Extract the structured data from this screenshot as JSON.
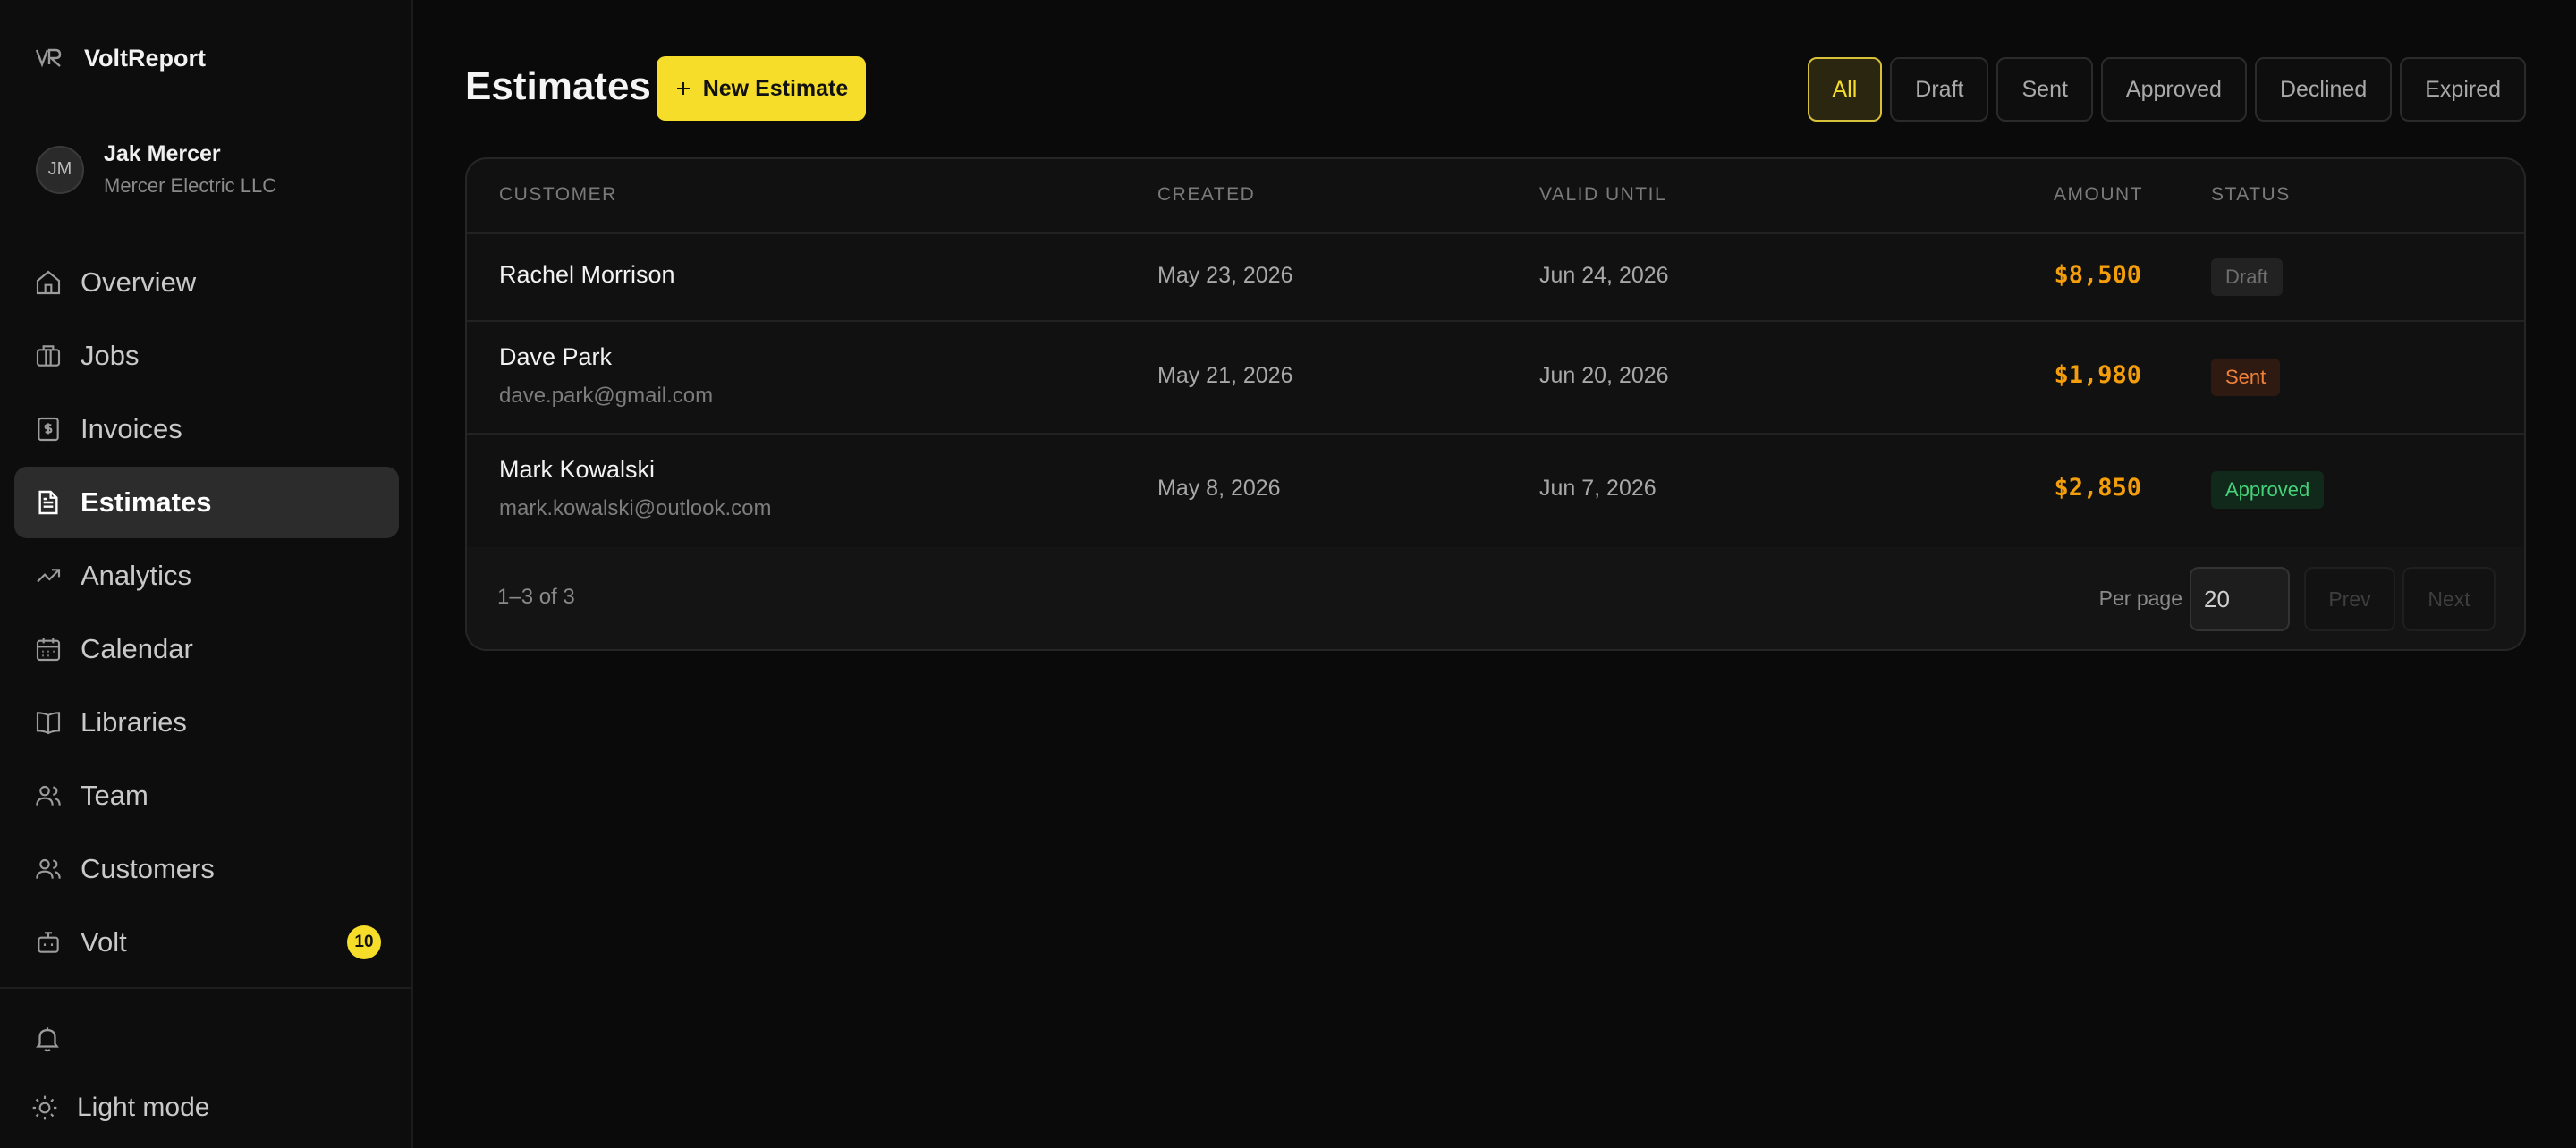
{
  "app": {
    "name": "VoltReport"
  },
  "user": {
    "initials": "JM",
    "name": "Jak Mercer",
    "company": "Mercer Electric LLC"
  },
  "nav": [
    {
      "label": "Overview",
      "icon": "home-icon"
    },
    {
      "label": "Jobs",
      "icon": "briefcase-icon"
    },
    {
      "label": "Invoices",
      "icon": "invoice-dollar-icon"
    },
    {
      "label": "Estimates",
      "icon": "document-icon",
      "active": true
    },
    {
      "label": "Analytics",
      "icon": "trending-up-icon"
    },
    {
      "label": "Calendar",
      "icon": "calendar-icon"
    },
    {
      "label": "Libraries",
      "icon": "book-icon"
    },
    {
      "label": "Team",
      "icon": "users-icon"
    },
    {
      "label": "Customers",
      "icon": "customers-icon"
    },
    {
      "label": "Volt",
      "icon": "bot-icon",
      "badge": "10"
    }
  ],
  "footer_nav": {
    "light_mode_label": "Light mode"
  },
  "page": {
    "title": "Estimates",
    "new_button_label": "New Estimate"
  },
  "filters": [
    "All",
    "Draft",
    "Sent",
    "Approved",
    "Declined",
    "Expired"
  ],
  "active_filter": "All",
  "table": {
    "columns": {
      "customer": "CUSTOMER",
      "created": "CREATED",
      "valid_until": "VALID UNTIL",
      "amount": "AMOUNT",
      "status": "STATUS"
    },
    "rows": [
      {
        "name": "Rachel Morrison",
        "email": "",
        "created": "May 23, 2026",
        "valid_until": "Jun 24, 2026",
        "amount": "$8,500",
        "status": "Draft"
      },
      {
        "name": "Dave Park",
        "email": "dave.park@gmail.com",
        "created": "May 21, 2026",
        "valid_until": "Jun 20, 2026",
        "amount": "$1,980",
        "status": "Sent"
      },
      {
        "name": "Mark Kowalski",
        "email": "mark.kowalski@outlook.com",
        "created": "May 8, 2026",
        "valid_until": "Jun 7, 2026",
        "amount": "$2,850",
        "status": "Approved"
      }
    ]
  },
  "pagination": {
    "summary": "1–3 of 3",
    "per_page_label": "Per page",
    "per_page_value": "20",
    "prev": "Prev",
    "next": "Next"
  },
  "colors": {
    "accent": "#f5dd2a",
    "amount": "#f59e0b",
    "sent": "#f0823a",
    "approved": "#45d27a"
  }
}
